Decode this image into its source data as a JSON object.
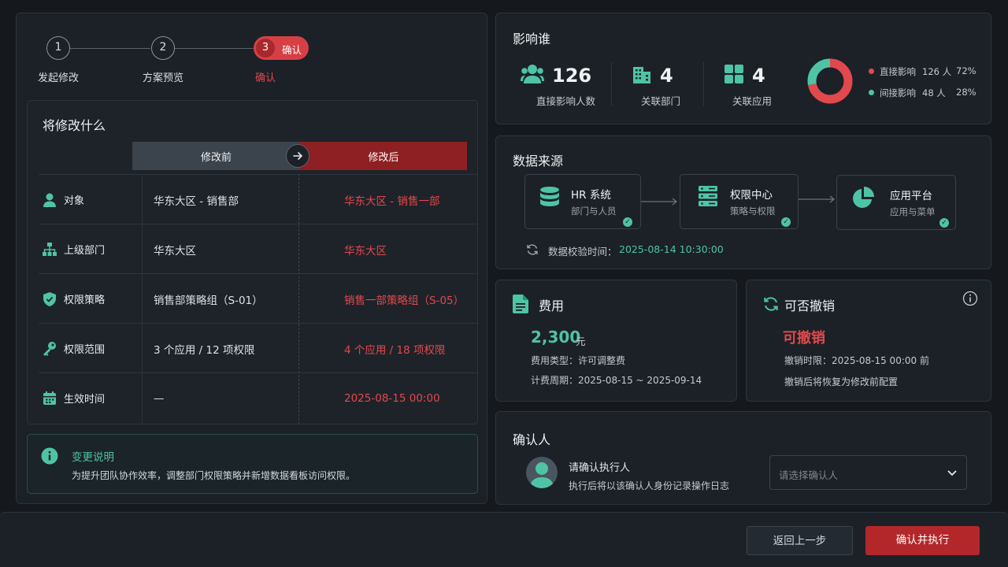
{
  "stepper": {
    "steps": [
      {
        "num": "1",
        "label": "发起修改"
      },
      {
        "num": "2",
        "label": "方案预览"
      },
      {
        "num": "3",
        "label": "确认"
      }
    ],
    "active_label": "确认"
  },
  "changes": {
    "title": "将修改什么",
    "before_header": "修改前",
    "after_header": "修改后",
    "rows": [
      {
        "label": "对象",
        "before": "华东大区 - 销售部",
        "after": "华东大区 - 销售一部"
      },
      {
        "label": "上级部门",
        "before": "华东大区",
        "after": "华东大区"
      },
      {
        "label": "权限策略",
        "before": "销售部策略组（S-01）",
        "after": "销售一部策略组（S-05）"
      },
      {
        "label": "权限范围",
        "before": "3 个应用 / 12 项权限",
        "after": "4 个应用 / 18 项权限"
      },
      {
        "label": "生效时间",
        "before": "—",
        "after": "2025-08-15 00:00"
      }
    ]
  },
  "note": {
    "title": "变更说明",
    "text": "为提升团队协作效率，调整部门权限策略并新增数据看板访问权限。"
  },
  "impact": {
    "title": "影响谁",
    "stats": [
      {
        "value": "126",
        "label": "直接影响人数",
        "icon": "users-icon"
      },
      {
        "value": "4",
        "label": "关联部门",
        "icon": "building-icon"
      },
      {
        "value": "4",
        "label": "关联应用",
        "icon": "apps-grid-icon"
      }
    ],
    "legend": [
      {
        "name": "直接影响",
        "count": "126 人",
        "pct": "72%",
        "color": "#e2494d",
        "fraction": 0.72
      },
      {
        "name": "间接影响",
        "count": "48 人",
        "pct": "28%",
        "color": "#4fc3a6",
        "fraction": 0.28
      }
    ]
  },
  "sources": {
    "title": "数据来源",
    "items": [
      {
        "title": "HR 系统",
        "sub": "部门与人员",
        "icon": "database-icon"
      },
      {
        "title": "权限中心",
        "sub": "策略与权限",
        "icon": "server-icon"
      },
      {
        "title": "应用平台",
        "sub": "应用与菜单",
        "icon": "pie-icon"
      }
    ],
    "verify_label": "数据校验时间：",
    "verify_time": "2025-08-14 10:30:00"
  },
  "cost": {
    "title": "费用",
    "amount": "2,300",
    "unit": "元",
    "type_line": "费用类型：许可调整费",
    "period_line": "计费周期：2025-08-15 ~ 2025-09-14"
  },
  "revoke": {
    "title": "可否撤销",
    "status": "可撤销",
    "deadline_line": "撤销时限：2025-08-15 00:00 前",
    "restore_line": "撤销后将恢复为修改前配置"
  },
  "confirmer": {
    "title": "确认人",
    "prompt": "请确认执行人",
    "hint": "执行后将以该确认人身份记录操作日志",
    "select_placeholder": "请选择确认人"
  },
  "footer": {
    "back_label": "返回上一步",
    "confirm_label": "确认并执行"
  },
  "colors": {
    "accent": "#4fc3a6",
    "danger": "#e2494d",
    "bg": "#15191e"
  }
}
